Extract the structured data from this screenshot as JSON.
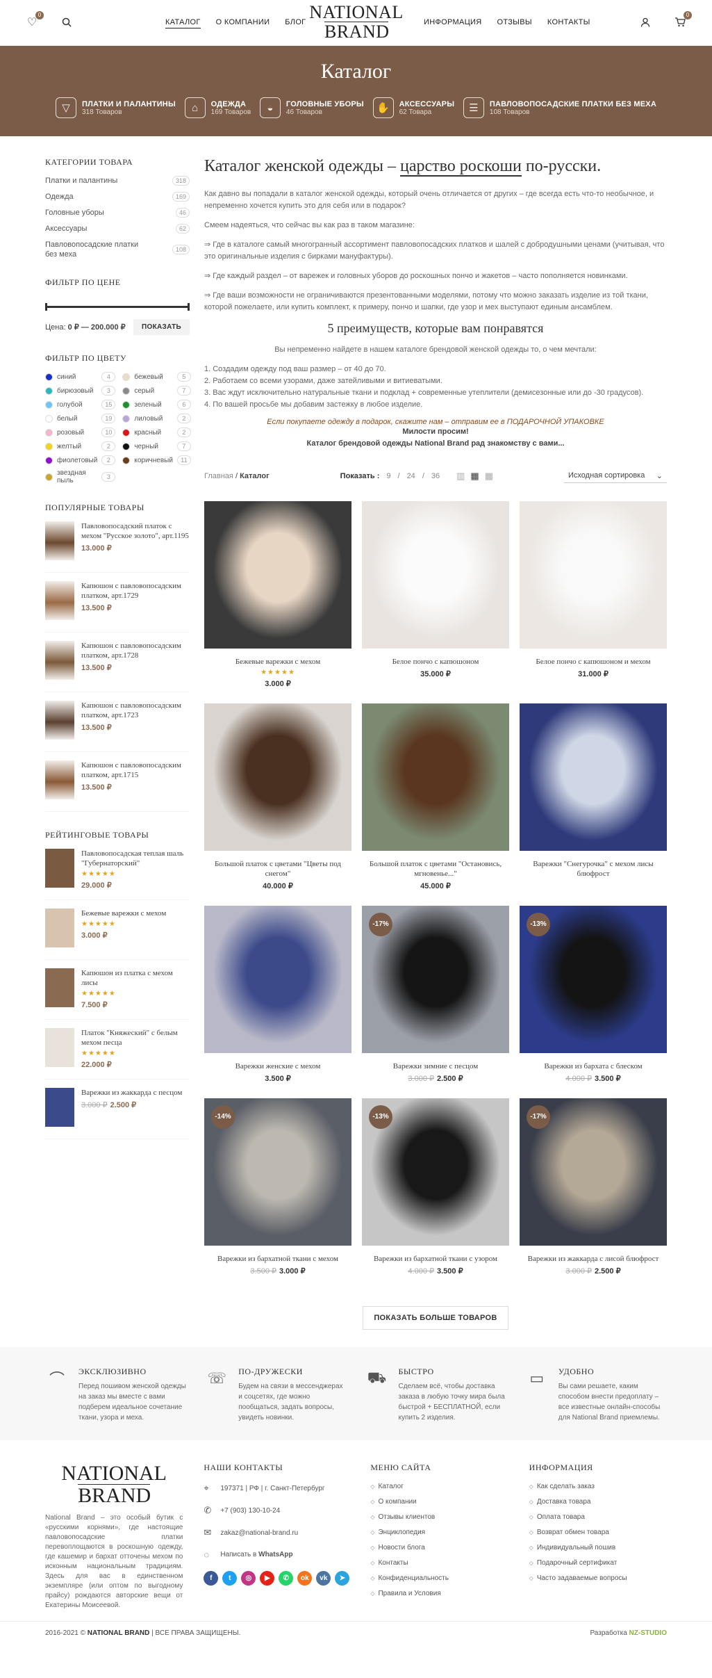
{
  "header": {
    "wishlist_count": "0",
    "cart_count": "0",
    "nav_left": [
      "КАТАЛОГ",
      "О КОМПАНИИ",
      "БЛОГ"
    ],
    "logo_line1": "NATIONAL",
    "logo_line2": "BRAND",
    "nav_right": [
      "ИНФОРМАЦИЯ",
      "ОТЗЫВЫ",
      "КОНТАКТЫ"
    ]
  },
  "banner": {
    "title": "Каталог",
    "categories": [
      {
        "name": "ПЛАТКИ И ПАЛАНТИНЫ",
        "count": "318 Товаров",
        "icon": "shawl-icon"
      },
      {
        "name": "ОДЕЖДА",
        "count": "169 Товаров",
        "icon": "coat-icon"
      },
      {
        "name": "ГОЛОВНЫЕ УБОРЫ",
        "count": "46 Товаров",
        "icon": "hat-icon"
      },
      {
        "name": "АКСЕССУАРЫ",
        "count": "62 Товара",
        "icon": "mittens-icon"
      },
      {
        "name": "ПАВЛОВОПОСАДСКИЕ ПЛАТКИ БЕЗ МЕХА",
        "count": "108 Товаров",
        "icon": "folded-scarf-icon"
      }
    ]
  },
  "sidebar": {
    "categories_title": "КАТЕГОРИИ ТОВАРА",
    "categories": [
      {
        "name": "Платки и палантины",
        "count": "318"
      },
      {
        "name": "Одежда",
        "count": "169"
      },
      {
        "name": "Головные уборы",
        "count": "46"
      },
      {
        "name": "Аксессуары",
        "count": "62"
      },
      {
        "name": "Павловопосадские платки без меха",
        "count": "108"
      }
    ],
    "price_title": "ФИЛЬТР ПО ЦЕНЕ",
    "price_label": "Цена:",
    "price_range": "0 ₽ — 200.000 ₽",
    "price_button": "ПОКАЗАТЬ",
    "color_title": "ФИЛЬТР ПО ЦВЕТУ",
    "colors": [
      {
        "name": "синий",
        "count": "4",
        "hex": "#1b2fc6"
      },
      {
        "name": "бежевый",
        "count": "5",
        "hex": "#eadcc8"
      },
      {
        "name": "бирюзовый",
        "count": "3",
        "hex": "#2ab7c0"
      },
      {
        "name": "серый",
        "count": "7",
        "hex": "#8a8a8a"
      },
      {
        "name": "голубой",
        "count": "15",
        "hex": "#6ec6f0"
      },
      {
        "name": "зеленый",
        "count": "6",
        "hex": "#1f8f2f"
      },
      {
        "name": "белый",
        "count": "19",
        "hex": "#ffffff"
      },
      {
        "name": "лиловый",
        "count": "2",
        "hex": "#b9a6d8"
      },
      {
        "name": "розовый",
        "count": "10",
        "hex": "#f5b6c6"
      },
      {
        "name": "красный",
        "count": "2",
        "hex": "#d8141c"
      },
      {
        "name": "желтый",
        "count": "2",
        "hex": "#f2d21a"
      },
      {
        "name": "черный",
        "count": "7",
        "hex": "#111111"
      },
      {
        "name": "фиолетовый",
        "count": "2",
        "hex": "#8a12c9"
      },
      {
        "name": "коричневый",
        "count": "11",
        "hex": "#6b3b1e"
      },
      {
        "name": "звездная пыль",
        "count": "3",
        "hex": "#c8a52c"
      }
    ],
    "popular_title": "ПОПУЛЯРНЫЕ ТОВАРЫ",
    "popular": [
      {
        "name": "Павловопосадский платок с мехом \"Русское золото\", арт.1195",
        "price": "13.000 ₽"
      },
      {
        "name": "Капюшон с павловопосадским платком, арт.1729",
        "price": "13.500 ₽"
      },
      {
        "name": "Капюшон с павловопосадским платком, арт.1728",
        "price": "13.500 ₽"
      },
      {
        "name": "Капюшон с павловопосадским платком, арт.1723",
        "price": "13.500 ₽"
      },
      {
        "name": "Капюшон с павловопосадским платком, арт.1715",
        "price": "13.500 ₽"
      }
    ],
    "rated_title": "РЕЙТИНГОВЫЕ ТОВАРЫ",
    "rated": [
      {
        "name": "Павловопосадская теплая шаль \"Губернаторский\"",
        "old": "",
        "price": "29.000 ₽"
      },
      {
        "name": "Бежевые варежки с мехом",
        "old": "",
        "price": "3.000 ₽"
      },
      {
        "name": "Капюшон из платка с мехом лисы",
        "old": "",
        "price": "7.500 ₽"
      },
      {
        "name": "Платок \"Княжеский\" с белым мехом песца",
        "old": "",
        "price": "22.000 ₽"
      },
      {
        "name": "Варежки из жаккарда с песцом",
        "old": "3.000 ₽",
        "price": "2.500 ₽"
      }
    ]
  },
  "content": {
    "heading_pre": "Каталог женской одежды – ",
    "heading_em": "царство роскоши",
    "heading_post": " по-русски.",
    "p1": "Как давно вы попадали в каталог женской одежды, который очень отличается от других – где всегда есть что-то необычное, и непременно хочется купить это для себя или в подарок?",
    "p2": "Смеем надеяться, что сейчас вы как раз в таком магазине:",
    "p3": "⇒ Где в каталоге самый многогранный ассортимент павловопосадских платков и шалей с добродушными ценами (учитывая, что это оригинальные изделия с бирками мануфактуры).",
    "p4": "⇒ Где каждый раздел – от варежек и головных уборов до роскошных пончо и жакетов – часто пополняется новинками.",
    "p5": "⇒ Где ваши возможности не ограничиваются презентованными моделями, потому что можно заказать изделие из той ткани, которой пожелаете, или купить комплект, к примеру, пончо и шапки, где узор и мех выступают единым ансамблем.",
    "sub_heading": "5 преимуществ, которые вам понравятся",
    "intro": "Вы непременно найдете в нашем каталоге брендовой женской одежды то, о чем мечтали:",
    "list": [
      "1. Создадим одежду под ваш размер – от 40 до 70.",
      "2. Работаем со всеми узорами, даже затейливыми и витиеватыми.",
      "3. Вас ждут исключительно натуральные ткани и подклад + современные утеплители (демисезонные или до -30 градусов).",
      "4. По вашей просьбе мы добавим застежку в любое изделие."
    ],
    "gift": "Если покупаете одежду в подарок, скажите нам – отправим ее в ПОДАРОЧНОЙ УПАКОВКЕ",
    "welcome1": "Милости просим!",
    "welcome2": "Каталог брендовой одежды National Brand рад знакомству с вами...",
    "breadcrumb_home": "Главная",
    "breadcrumb_sep": "/",
    "breadcrumb_current": "Каталог",
    "show_label": "Показать :",
    "show_opts": [
      "9",
      "24",
      "36"
    ],
    "sort": "Исходная сортировка",
    "load_more": "ПОКАЗАТЬ БОЛЬШЕ ТОВАРОВ"
  },
  "products": [
    {
      "name": "Бежевые варежки с мехом",
      "old": "",
      "price": "3.000 ₽",
      "sale": "",
      "stars": "★★★★★",
      "bg": "#3a3a3a",
      "fg": "#e8d6c4"
    },
    {
      "name": "Белое пончо с капюшоном",
      "old": "",
      "price": "35.000 ₽",
      "sale": "",
      "stars": "",
      "bg": "#e9e4e0",
      "fg": "#fbfbfb"
    },
    {
      "name": "Белое пончо с капюшоном и мехом",
      "old": "",
      "price": "31.000 ₽",
      "sale": "",
      "stars": "",
      "bg": "#ece7e2",
      "fg": "#f9f9f9"
    },
    {
      "name": "Большой платок с цветами \"Цветы под снегом\"",
      "old": "",
      "price": "40.000 ₽",
      "sale": "",
      "stars": "",
      "bg": "#d9d4cf",
      "fg": "#4a3020"
    },
    {
      "name": "Большой платок с цветами \"Остановись, мгновенье...\"",
      "old": "",
      "price": "45.000 ₽",
      "sale": "",
      "stars": "",
      "bg": "#7c8a72",
      "fg": "#5a3620"
    },
    {
      "name": "Варежки \"Снегурочка\" с мехом лисы блюфрост",
      "old": "",
      "price": "",
      "sale": "",
      "stars": "",
      "bg": "#2e3a7a",
      "fg": "#cfd6e6"
    },
    {
      "name": "Варежки женские с мехом",
      "old": "",
      "price": "3.500 ₽",
      "sale": "",
      "stars": "",
      "bg": "#b8b8c8",
      "fg": "#3c4a8a"
    },
    {
      "name": "Варежки зимние с песцом",
      "old": "3.000 ₽",
      "price": "2.500 ₽",
      "sale": "-17%",
      "stars": "",
      "bg": "#9b9fa8",
      "fg": "#151515"
    },
    {
      "name": "Варежки из бархата с блеском",
      "old": "4.000 ₽",
      "price": "3.500 ₽",
      "sale": "-13%",
      "stars": "",
      "bg": "#2c3c8a",
      "fg": "#141414"
    },
    {
      "name": "Варежки из бархатной ткани с мехом",
      "old": "3.500 ₽",
      "price": "3.000 ₽",
      "sale": "-14%",
      "stars": "",
      "bg": "#5a5e66",
      "fg": "#bdb8b0"
    },
    {
      "name": "Варежки из бархатной ткани с узором",
      "old": "4.000 ₽",
      "price": "3.500 ₽",
      "sale": "-13%",
      "stars": "",
      "bg": "#c6c6c6",
      "fg": "#181818"
    },
    {
      "name": "Варежки из жаккарда с лисой блюфрост",
      "old": "3.000 ₽",
      "price": "2.500 ₽",
      "sale": "-17%",
      "stars": "",
      "bg": "#3a3e4a",
      "fg": "#b4a896"
    }
  ],
  "features": [
    {
      "title": "ЭКСКЛЮЗИВНО",
      "text": "Перед пошивом женской одежды на заказ мы вместе с вами подберем идеальное сочетание ткани, узора и меха.",
      "icon": "hanger-icon"
    },
    {
      "title": "ПО-ДРУЖЕСКИ",
      "text": "Будем на связи в мессенджерах и соцсетях, где можно пообщаться, задать вопросы, увидеть новинки.",
      "icon": "support-24-icon"
    },
    {
      "title": "БЫСТРО",
      "text": "Сделаем всё, чтобы доставка заказа в любую точку мира была быстрой + БЕСПЛАТНОЙ, если купить 2 изделия.",
      "icon": "free-delivery-icon"
    },
    {
      "title": "УДОБНО",
      "text": "Вы сами решаете, каким способом внести предоплату – все известные онлайн-способы для National Brand приемлемы.",
      "icon": "payment-icon"
    }
  ],
  "footer": {
    "logo_line1": "NATIONAL",
    "logo_line2": "BRAND",
    "about": "National Brand – это особый бутик с «русскими корнями», где настоящие павловопосадские платки перевоплощаются в роскошную одежду, где кашемир и бархат отточены мехом по исконным национальным традициям. Здесь для вас в единственном экземпляре (или оптом по выгодному прайсу) рождаются авторские вещи от Екатерины Моисеевой.",
    "contacts_title": "НАШИ КОНТАКТЫ",
    "address": "197371 | РФ | г. Санкт-Петербург",
    "phone": "+7 (903) 130-10-24",
    "email": "zakaz@national-brand.ru",
    "whatsapp_pre": "Написать в ",
    "whatsapp": "WhatsApp",
    "socials": [
      {
        "label": "f",
        "color": "#3b5998"
      },
      {
        "label": "t",
        "color": "#1da1f2"
      },
      {
        "label": "◎",
        "color": "#c13584"
      },
      {
        "label": "▶",
        "color": "#e62117"
      },
      {
        "label": "✆",
        "color": "#25d366"
      },
      {
        "label": "ok",
        "color": "#f4731c"
      },
      {
        "label": "vk",
        "color": "#4c75a3"
      },
      {
        "label": "➤",
        "color": "#2aa3df"
      }
    ],
    "menu_title": "МЕНЮ САЙТА",
    "menu": [
      "Каталог",
      "О компании",
      "Отзывы клиентов",
      "Энциклопедия",
      "Новости блога",
      "Контакты",
      "Конфиденциальность",
      "Правила и Условия"
    ],
    "info_title": "ИНФОРМАЦИЯ",
    "info": [
      "Как сделать заказ",
      "Доставка товара",
      "Оплата товара",
      "Возврат обмен товара",
      "Индивидуальный пошив",
      "Подарочный сертификат",
      "Часто задаваемые вопросы"
    ]
  },
  "bottom": {
    "copy_pre": "2016-2021 © ",
    "copy_brand": "NATIONAL BRAND",
    "copy_post": " | ВСЕ ПРАВА ЗАЩИЩЕНЫ.",
    "dev_pre": "Разработка ",
    "dev": "NZ-STUDIO"
  }
}
